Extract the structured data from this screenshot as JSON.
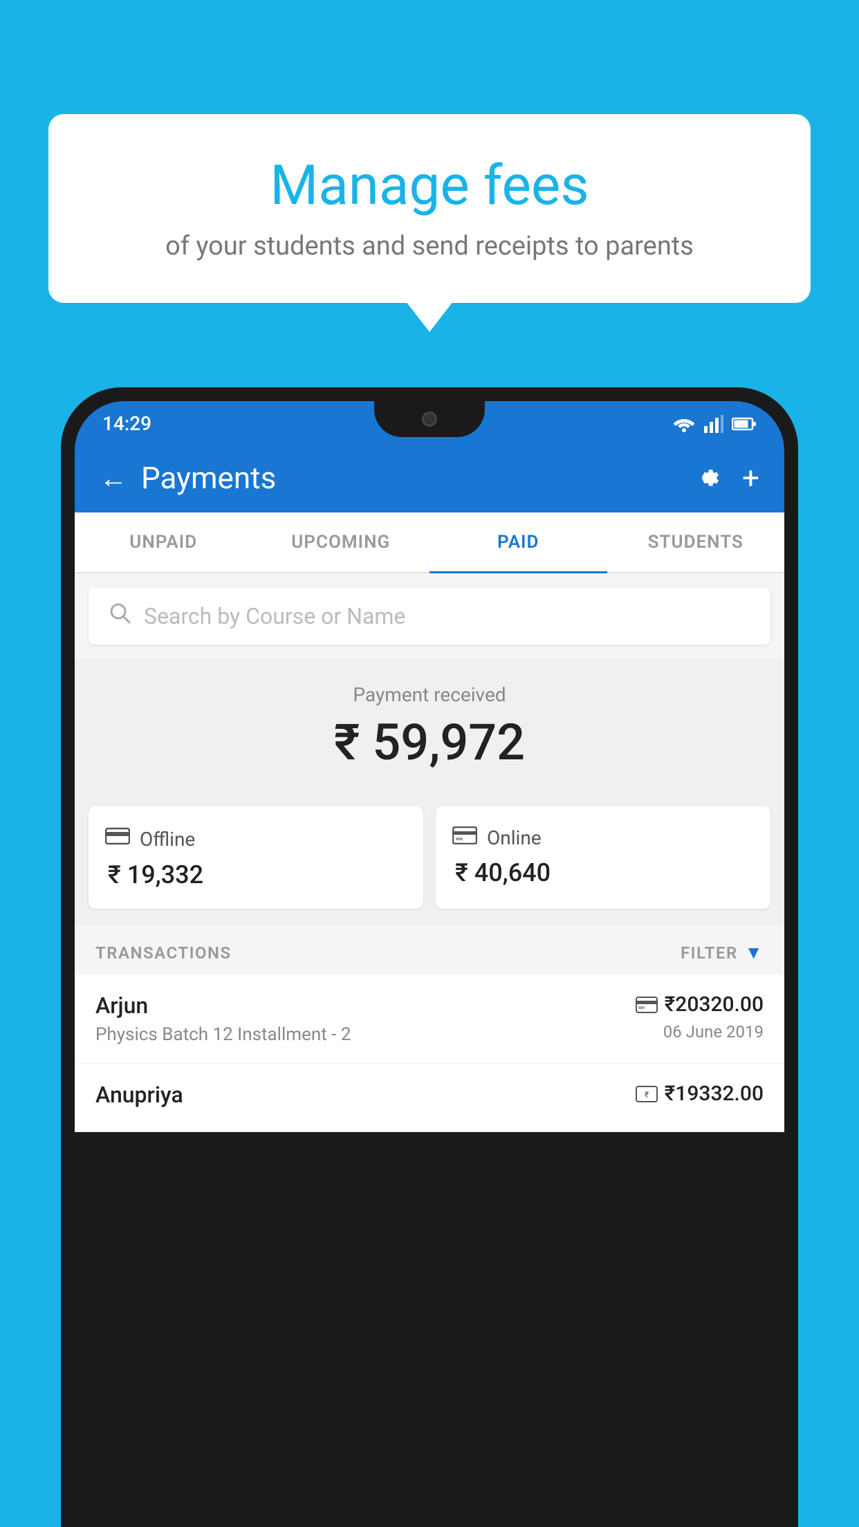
{
  "background_color": "#1ab3e8",
  "bubble": {
    "title": "Manage fees",
    "subtitle": "of your students and send receipts to parents"
  },
  "status_bar": {
    "time": "14:29"
  },
  "app_bar": {
    "title": "Payments",
    "back_label": "←"
  },
  "tabs": [
    {
      "label": "UNPAID",
      "active": false
    },
    {
      "label": "UPCOMING",
      "active": false
    },
    {
      "label": "PAID",
      "active": true
    },
    {
      "label": "STUDENTS",
      "active": false
    }
  ],
  "search": {
    "placeholder": "Search by Course or Name"
  },
  "payment_received": {
    "label": "Payment received",
    "amount": "₹ 59,972"
  },
  "payment_cards": [
    {
      "type": "Offline",
      "amount": "₹ 19,332",
      "icon": "₹"
    },
    {
      "type": "Online",
      "amount": "₹ 40,640",
      "icon": "💳"
    }
  ],
  "transactions_section": {
    "label": "TRANSACTIONS",
    "filter_label": "FILTER"
  },
  "transactions": [
    {
      "name": "Arjun",
      "course": "Physics Batch 12 Installment - 2",
      "amount": "₹20320.00",
      "date": "06 June 2019",
      "method_icon": "card"
    },
    {
      "name": "Anupriya",
      "course": "",
      "amount": "₹19332.00",
      "date": "",
      "method_icon": "cash"
    }
  ]
}
